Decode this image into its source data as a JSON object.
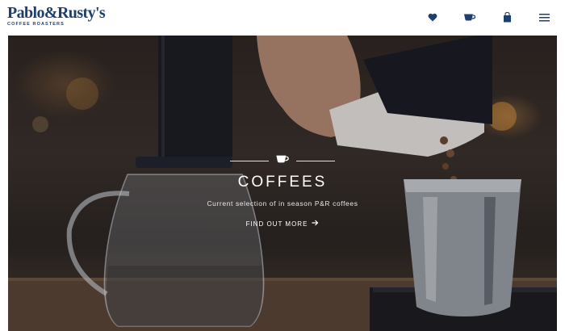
{
  "header": {
    "logo_name": "Pablo&Rusty's",
    "logo_tagline": "COFFEE ROASTERS",
    "nav_icons": [
      "heart-icon",
      "cup-icon",
      "bag-icon",
      "menu-icon"
    ]
  },
  "hero": {
    "title": "COFFEES",
    "subtitle": "Current selection of in season P&R coffees",
    "link_label": "FIND OUT MORE",
    "link_icon": "arrow-right-icon"
  },
  "colors": {
    "brand_navy": "#1c3f6e",
    "hero_text": "#ffffff"
  }
}
